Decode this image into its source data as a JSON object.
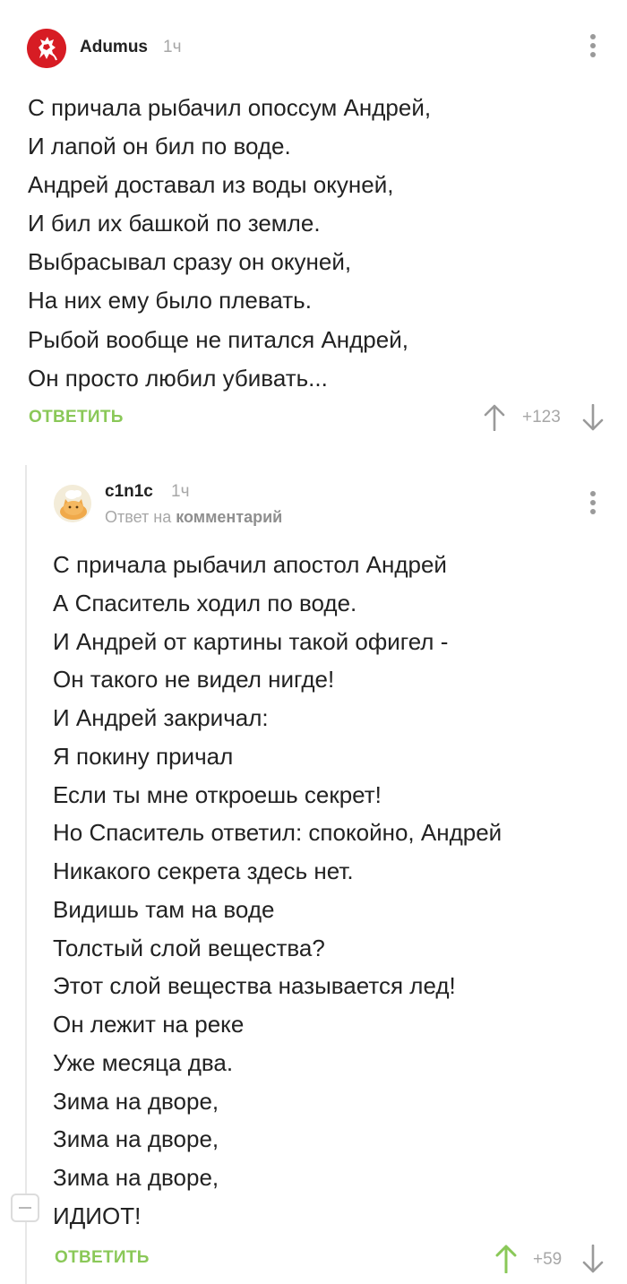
{
  "comments": [
    {
      "author": "Adumus",
      "time": "1ч",
      "lines": [
        "С причала рыбачил опоссум Андрей,",
        "И лапой он бил по воде.",
        "Андрей доставал из воды окуней,",
        "И бил их башкой по земле.",
        "Выбрасывал сразу он окуней,",
        "На них ему было плевать.",
        "Рыбой вообще не питался Андрей,",
        "Он просто любил убивать..."
      ],
      "reply_label": "ОТВЕТИТЬ",
      "rating": "+123"
    },
    {
      "author": "c1n1c",
      "time": "1ч",
      "reply_prefix": "Ответ на",
      "reply_target": "комментарий",
      "lines": [
        "С причала рыбачил апостол Андрей",
        "А Спаситель ходил по воде.",
        "И Андрей от картины такой офигел -",
        "Он такого не видел нигде!",
        "И Андрей закричал:",
        "Я покину причал",
        "Если ты мне откроешь секрет!",
        "Но Спаситель ответил: спокойно, Андрей",
        "Никакого секрета здесь нет.",
        "Видишь там на воде",
        "Толстый слой вещества?",
        "Этот слой вещества называется лед!",
        "Он лежит на реке",
        "Уже месяца два.",
        "Зима на дворе,",
        "Зима на дворе,",
        "Зима на дворе,",
        "ИДИОТ!"
      ],
      "reply_label": "ОТВЕТИТЬ",
      "rating": "+59"
    }
  ],
  "colors": {
    "accent": "#8ac858",
    "muted": "#a7a7a7",
    "text": "#222222",
    "avatar_red": "#d71c24"
  },
  "icons": [
    "lion-avatar-icon",
    "cat-avatar-icon",
    "more-vertical-icon",
    "arrow-up-icon",
    "arrow-down-icon",
    "collapse-icon"
  ]
}
